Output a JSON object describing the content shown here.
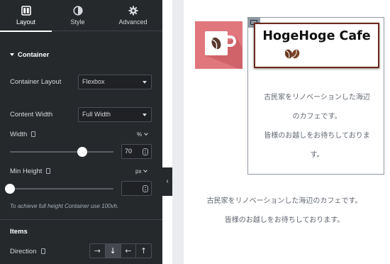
{
  "panel": {
    "tabs": [
      {
        "label": "Layout",
        "icon": "layout-icon",
        "active": true
      },
      {
        "label": "Style",
        "icon": "half-circle-icon",
        "active": false
      },
      {
        "label": "Advanced",
        "icon": "gear-icon",
        "active": false
      }
    ],
    "section_title": "Container",
    "container_layout": {
      "label": "Container Layout",
      "value": "Flexbox"
    },
    "content_width": {
      "label": "Content Width",
      "value": "Full Width"
    },
    "width": {
      "label": "Width",
      "unit": "%",
      "value": "70",
      "slider_fraction": 0.7
    },
    "min_height": {
      "label": "Min Height",
      "unit": "px",
      "value": "",
      "slider_fraction": 0
    },
    "hint": "To achieve full height Container use 100vh.",
    "items_title": "Items",
    "direction": {
      "label": "Direction",
      "options": [
        {
          "glyph": "→",
          "name": "row",
          "selected": false
        },
        {
          "glyph": "↓",
          "name": "column",
          "selected": true
        },
        {
          "glyph": "←",
          "name": "row-reverse",
          "selected": false
        },
        {
          "glyph": "↑",
          "name": "column-reverse",
          "selected": false
        }
      ]
    },
    "collapse_glyph": "‹"
  },
  "preview": {
    "heading": "HogeHoge Cafe",
    "inner_text": [
      "古民家をリノベーションした海辺",
      "のカフェです。",
      "皆様のお越しをお待ちしておりま",
      "す。"
    ],
    "outer_text": [
      "古民家をリノベーションした海辺のカフェです。",
      "皆様のお越しをお待ちしております。"
    ]
  },
  "colors": {
    "panel_bg": "#26292c",
    "cup_tile": "#e0777d",
    "heading_border": "#6b2a1e",
    "bean": "#6b3a1f"
  }
}
